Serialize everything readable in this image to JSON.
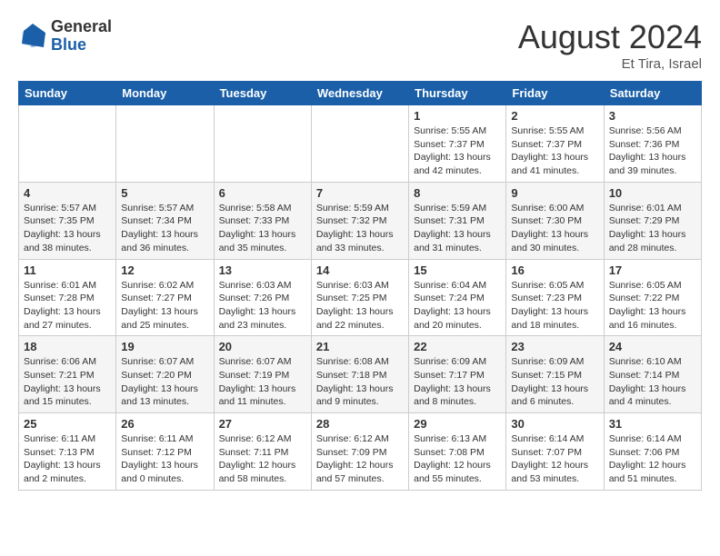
{
  "header": {
    "logo_general": "General",
    "logo_blue": "Blue",
    "month_title": "August 2024",
    "location": "Et Tira, Israel"
  },
  "weekdays": [
    "Sunday",
    "Monday",
    "Tuesday",
    "Wednesday",
    "Thursday",
    "Friday",
    "Saturday"
  ],
  "weeks": [
    [
      {
        "day": "",
        "info": ""
      },
      {
        "day": "",
        "info": ""
      },
      {
        "day": "",
        "info": ""
      },
      {
        "day": "",
        "info": ""
      },
      {
        "day": "1",
        "info": "Sunrise: 5:55 AM\nSunset: 7:37 PM\nDaylight: 13 hours\nand 42 minutes."
      },
      {
        "day": "2",
        "info": "Sunrise: 5:55 AM\nSunset: 7:37 PM\nDaylight: 13 hours\nand 41 minutes."
      },
      {
        "day": "3",
        "info": "Sunrise: 5:56 AM\nSunset: 7:36 PM\nDaylight: 13 hours\nand 39 minutes."
      }
    ],
    [
      {
        "day": "4",
        "info": "Sunrise: 5:57 AM\nSunset: 7:35 PM\nDaylight: 13 hours\nand 38 minutes."
      },
      {
        "day": "5",
        "info": "Sunrise: 5:57 AM\nSunset: 7:34 PM\nDaylight: 13 hours\nand 36 minutes."
      },
      {
        "day": "6",
        "info": "Sunrise: 5:58 AM\nSunset: 7:33 PM\nDaylight: 13 hours\nand 35 minutes."
      },
      {
        "day": "7",
        "info": "Sunrise: 5:59 AM\nSunset: 7:32 PM\nDaylight: 13 hours\nand 33 minutes."
      },
      {
        "day": "8",
        "info": "Sunrise: 5:59 AM\nSunset: 7:31 PM\nDaylight: 13 hours\nand 31 minutes."
      },
      {
        "day": "9",
        "info": "Sunrise: 6:00 AM\nSunset: 7:30 PM\nDaylight: 13 hours\nand 30 minutes."
      },
      {
        "day": "10",
        "info": "Sunrise: 6:01 AM\nSunset: 7:29 PM\nDaylight: 13 hours\nand 28 minutes."
      }
    ],
    [
      {
        "day": "11",
        "info": "Sunrise: 6:01 AM\nSunset: 7:28 PM\nDaylight: 13 hours\nand 27 minutes."
      },
      {
        "day": "12",
        "info": "Sunrise: 6:02 AM\nSunset: 7:27 PM\nDaylight: 13 hours\nand 25 minutes."
      },
      {
        "day": "13",
        "info": "Sunrise: 6:03 AM\nSunset: 7:26 PM\nDaylight: 13 hours\nand 23 minutes."
      },
      {
        "day": "14",
        "info": "Sunrise: 6:03 AM\nSunset: 7:25 PM\nDaylight: 13 hours\nand 22 minutes."
      },
      {
        "day": "15",
        "info": "Sunrise: 6:04 AM\nSunset: 7:24 PM\nDaylight: 13 hours\nand 20 minutes."
      },
      {
        "day": "16",
        "info": "Sunrise: 6:05 AM\nSunset: 7:23 PM\nDaylight: 13 hours\nand 18 minutes."
      },
      {
        "day": "17",
        "info": "Sunrise: 6:05 AM\nSunset: 7:22 PM\nDaylight: 13 hours\nand 16 minutes."
      }
    ],
    [
      {
        "day": "18",
        "info": "Sunrise: 6:06 AM\nSunset: 7:21 PM\nDaylight: 13 hours\nand 15 minutes."
      },
      {
        "day": "19",
        "info": "Sunrise: 6:07 AM\nSunset: 7:20 PM\nDaylight: 13 hours\nand 13 minutes."
      },
      {
        "day": "20",
        "info": "Sunrise: 6:07 AM\nSunset: 7:19 PM\nDaylight: 13 hours\nand 11 minutes."
      },
      {
        "day": "21",
        "info": "Sunrise: 6:08 AM\nSunset: 7:18 PM\nDaylight: 13 hours\nand 9 minutes."
      },
      {
        "day": "22",
        "info": "Sunrise: 6:09 AM\nSunset: 7:17 PM\nDaylight: 13 hours\nand 8 minutes."
      },
      {
        "day": "23",
        "info": "Sunrise: 6:09 AM\nSunset: 7:15 PM\nDaylight: 13 hours\nand 6 minutes."
      },
      {
        "day": "24",
        "info": "Sunrise: 6:10 AM\nSunset: 7:14 PM\nDaylight: 13 hours\nand 4 minutes."
      }
    ],
    [
      {
        "day": "25",
        "info": "Sunrise: 6:11 AM\nSunset: 7:13 PM\nDaylight: 13 hours\nand 2 minutes."
      },
      {
        "day": "26",
        "info": "Sunrise: 6:11 AM\nSunset: 7:12 PM\nDaylight: 13 hours\nand 0 minutes."
      },
      {
        "day": "27",
        "info": "Sunrise: 6:12 AM\nSunset: 7:11 PM\nDaylight: 12 hours\nand 58 minutes."
      },
      {
        "day": "28",
        "info": "Sunrise: 6:12 AM\nSunset: 7:09 PM\nDaylight: 12 hours\nand 57 minutes."
      },
      {
        "day": "29",
        "info": "Sunrise: 6:13 AM\nSunset: 7:08 PM\nDaylight: 12 hours\nand 55 minutes."
      },
      {
        "day": "30",
        "info": "Sunrise: 6:14 AM\nSunset: 7:07 PM\nDaylight: 12 hours\nand 53 minutes."
      },
      {
        "day": "31",
        "info": "Sunrise: 6:14 AM\nSunset: 7:06 PM\nDaylight: 12 hours\nand 51 minutes."
      }
    ]
  ]
}
